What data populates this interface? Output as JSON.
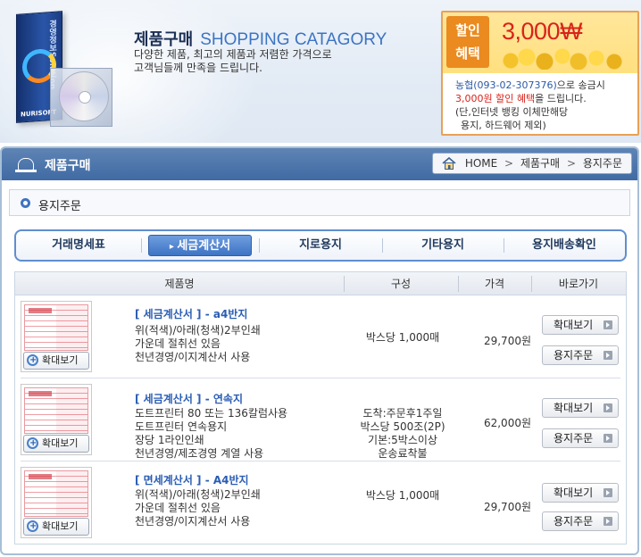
{
  "banner": {
    "title_ko": "제품구매",
    "title_en": "SHOPPING CATAGORY",
    "desc_line1": "다양한 제품, 최고의 제품과 저렴한 가격으로",
    "desc_line2": "고객님들께 만족을 드립니다.",
    "box_label": "경영정보Solution",
    "box_brand": "NURISOFT"
  },
  "discount": {
    "tag_line1": "할인",
    "tag_line2": "혜택",
    "amount": "3,000₩",
    "phone": "농협(093-02-307376)",
    "line1_suffix": "으로 송금시",
    "line2_highlight": "3,000원 할인 혜택",
    "line2_suffix": "을 드립니다.",
    "line3": "(단,인터넷 뱅킹 이체만해당",
    "line4": "용지, 하드웨어 제외)"
  },
  "section": {
    "title": "제품구매",
    "breadcrumb": [
      "HOME",
      "제품구매",
      "용지주문"
    ],
    "sub_title": "용지주문"
  },
  "tabs": [
    {
      "label": "거래명세표"
    },
    {
      "label": "세금계산서",
      "active": true
    },
    {
      "label": "지로용지"
    },
    {
      "label": "기타용지"
    },
    {
      "label": "용지배송확인"
    }
  ],
  "table": {
    "headers": [
      "제품명",
      "구성",
      "가격",
      "바로가기"
    ],
    "zoom_label": "확대보기",
    "rows": [
      {
        "title": "[ 세금계산서 ] - a4반지",
        "desc": [
          "위(적색)/아래(청색)2부인쇄",
          "가운데 절취선 있음",
          "천년경영/이지계산서 사용"
        ],
        "composition": [
          "박스당 1,000매"
        ],
        "price": "29,700원",
        "btn_zoom": "확대보기",
        "btn_order": "용지주문"
      },
      {
        "title": "[ 세금계산서 ] - 연속지",
        "desc": [
          "도트프린터 80 또는 136칼럼사용",
          "도트프린터 연속용지",
          "장당 1라인인쇄",
          "천년경영/제조경영 계열 사용"
        ],
        "composition": [
          "도착:주문후1주일",
          "박스당 500조(2P)",
          "기본:5박스이상",
          "운송료착불"
        ],
        "price": "62,000원",
        "btn_zoom": "확대보기",
        "btn_order": "용지주문"
      },
      {
        "title": "[ 면세계산서 ] - A4반지",
        "desc": [
          "위(적색)/아래(청색)2부인쇄",
          "가운데 절취선 있음",
          "천년경영/이지계산서 사용"
        ],
        "composition": [
          "박스당 1,000매"
        ],
        "price": "29,700원",
        "btn_zoom": "확대보기",
        "btn_order": "용지주문"
      }
    ]
  }
}
